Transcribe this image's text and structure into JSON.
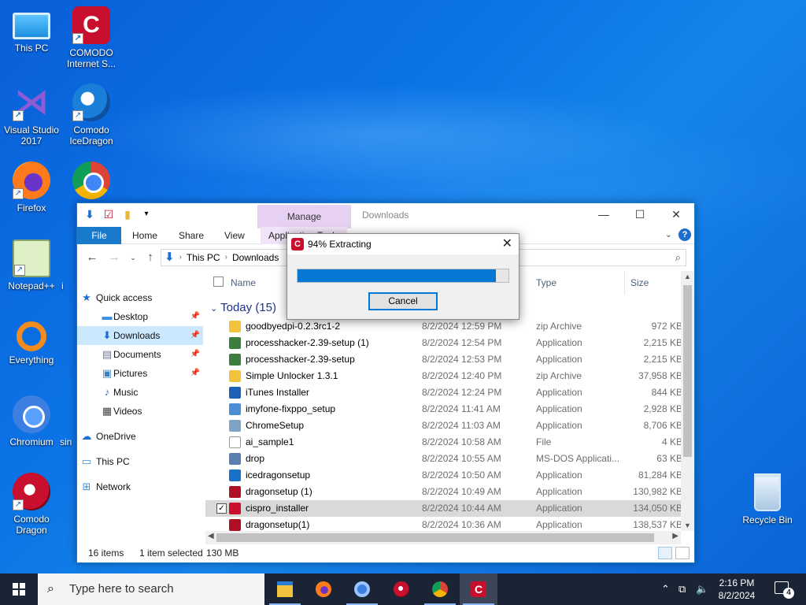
{
  "desktop": {
    "icons": [
      {
        "label": "This PC",
        "icon": "this-pc-icon"
      },
      {
        "label": "COMODO Internet S...",
        "icon": "comodo-icon"
      },
      {
        "label": "Visual Studio 2017",
        "icon": "visual-studio-icon"
      },
      {
        "label": "Comodo IceDragon",
        "icon": "icedragon-icon"
      },
      {
        "label": "Firefox",
        "icon": "firefox-icon"
      },
      {
        "label": "Notepad++",
        "icon": "notepadpp-icon"
      },
      {
        "label": "Everything",
        "icon": "everything-icon"
      },
      {
        "label": "Chromium",
        "icon": "chromium-icon"
      },
      {
        "label": "Comodo Dragon",
        "icon": "comodo-dragon-icon"
      },
      {
        "label": "Recycle Bin",
        "icon": "recycle-bin-icon"
      }
    ],
    "partial_labels": [
      "i",
      "sin"
    ]
  },
  "explorer": {
    "title": "Downloads",
    "manage_tab": "Manage",
    "ribbon_tabs": [
      "File",
      "Home",
      "Share",
      "View",
      "Application Tools"
    ],
    "address": {
      "root": "This PC",
      "folder": "Downloads"
    },
    "nav": {
      "quick_access": "Quick access",
      "items": [
        {
          "label": "Desktop",
          "icon": "desktop-folder-icon",
          "pinned": true
        },
        {
          "label": "Downloads",
          "icon": "downloads-folder-icon",
          "pinned": true
        },
        {
          "label": "Documents",
          "icon": "documents-folder-icon",
          "pinned": true
        },
        {
          "label": "Pictures",
          "icon": "pictures-folder-icon",
          "pinned": true
        },
        {
          "label": "Music",
          "icon": "music-folder-icon",
          "pinned": false
        },
        {
          "label": "Videos",
          "icon": "videos-folder-icon",
          "pinned": false
        }
      ],
      "onedrive": "OneDrive",
      "this_pc": "This PC",
      "network": "Network"
    },
    "columns": {
      "name": "Name",
      "type": "Type",
      "size": "Size"
    },
    "group": "Today (15)",
    "files": [
      {
        "name": "goodbyedpi-0.2.3rc1-2",
        "date": "8/2/2024 12:59 PM",
        "type": "zip Archive",
        "size": "972 KB",
        "icon": "zip-icon",
        "color": "#f2c43d"
      },
      {
        "name": "processhacker-2.39-setup (1)",
        "date": "8/2/2024 12:54 PM",
        "type": "Application",
        "size": "2,215 KB",
        "icon": "processhacker-icon",
        "color": "#3d7d3d"
      },
      {
        "name": "processhacker-2.39-setup",
        "date": "8/2/2024 12:53 PM",
        "type": "Application",
        "size": "2,215 KB",
        "icon": "processhacker-icon",
        "color": "#3d7d3d"
      },
      {
        "name": "Simple Unlocker 1.3.1",
        "date": "8/2/2024 12:40 PM",
        "type": "zip Archive",
        "size": "37,958 KB",
        "icon": "zip-icon",
        "color": "#f2c43d"
      },
      {
        "name": "iTunes Installer",
        "date": "8/2/2024 12:24 PM",
        "type": "Application",
        "size": "844 KB",
        "icon": "installer-icon",
        "color": "#1e5fb8"
      },
      {
        "name": "imyfone-fixppo_setup",
        "date": "8/2/2024 11:41 AM",
        "type": "Application",
        "size": "2,928 KB",
        "icon": "imyfone-icon",
        "color": "#4a8fd6"
      },
      {
        "name": "ChromeSetup",
        "date": "8/2/2024 11:03 AM",
        "type": "Application",
        "size": "8,706 KB",
        "icon": "setup-icon",
        "color": "#7fa3c7"
      },
      {
        "name": "ai_sample1",
        "date": "8/2/2024 10:58 AM",
        "type": "File",
        "size": "4 KB",
        "icon": "blank-file-icon",
        "color": "#ffffff"
      },
      {
        "name": "drop",
        "date": "8/2/2024 10:55 AM",
        "type": "MS-DOS Applicati...",
        "size": "63 KB",
        "icon": "msdos-icon",
        "color": "#5b7fb0"
      },
      {
        "name": "icedragonsetup",
        "date": "8/2/2024 10:50 AM",
        "type": "Application",
        "size": "81,284 KB",
        "icon": "icedragon-icon",
        "color": "#1a6fc9"
      },
      {
        "name": "dragonsetup (1)",
        "date": "8/2/2024 10:49 AM",
        "type": "Application",
        "size": "130,982 KB",
        "icon": "dragon-icon",
        "color": "#b01024"
      },
      {
        "name": "cispro_installer",
        "date": "8/2/2024 10:44 AM",
        "type": "Application",
        "size": "134,050 KB",
        "icon": "comodo-icon",
        "color": "#c8102e",
        "selected": true
      },
      {
        "name": "dragonsetup(1)",
        "date": "8/2/2024 10:36 AM",
        "type": "Application",
        "size": "138,537 KB",
        "icon": "dragon-icon",
        "color": "#b01024"
      }
    ],
    "status": {
      "count": "16 items",
      "selected": "1 item selected",
      "size": "130 MB"
    }
  },
  "dialog": {
    "title": "94% Extracting",
    "progress": 0.94,
    "cancel": "Cancel"
  },
  "taskbar": {
    "search_placeholder": "Type here to search",
    "time": "2:16 PM",
    "date": "8/2/2024",
    "notifications": "4",
    "apps": [
      "file-explorer-icon",
      "firefox-icon",
      "chromium-icon",
      "comodo-dragon-icon",
      "chrome-icon",
      "comodo-icon"
    ]
  }
}
